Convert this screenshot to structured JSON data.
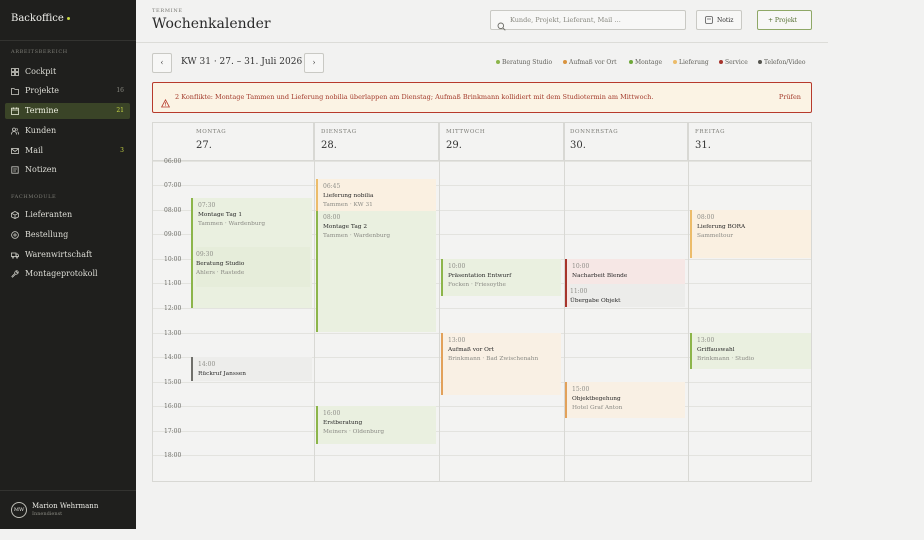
{
  "app": {
    "brand": "Backoffice"
  },
  "sidebar": {
    "section1": "ARBEITSBEREICH",
    "section2": "FACHMODULE",
    "items": [
      {
        "label": "Cockpit",
        "count": "",
        "icon": "grid-icon"
      },
      {
        "label": "Projekte",
        "count": "16",
        "icon": "folder-icon"
      },
      {
        "label": "Termine",
        "count": "21",
        "icon": "calendar-icon"
      },
      {
        "label": "Kunden",
        "count": "",
        "icon": "users-icon"
      },
      {
        "label": "Mail",
        "count": "3",
        "icon": "mail-icon"
      },
      {
        "label": "Notizen",
        "count": "",
        "icon": "note-icon"
      }
    ],
    "modules": [
      {
        "label": "Lieferanten",
        "icon": "box-icon"
      },
      {
        "label": "Bestellung",
        "icon": "package-icon"
      },
      {
        "label": "Warenwirtschaft",
        "icon": "truck-icon"
      },
      {
        "label": "Montageprotokoll",
        "icon": "wrench-icon"
      }
    ],
    "user": {
      "initials": "MW",
      "name": "Marion Wehrmann",
      "role": "Innendienst"
    }
  },
  "header": {
    "kicker": "TERMINE",
    "title": "Wochenkalender",
    "search_placeholder": "Kunde, Projekt, Lieferant, Mail …",
    "notiz_label": "Notiz",
    "projekt_label": "+ Projekt"
  },
  "week": {
    "prev": "‹",
    "next": "›",
    "label": "KW 31 · 27. – 31. Juli 2026"
  },
  "legend": [
    {
      "label": "Beratung Studio",
      "color": "#8cb54a"
    },
    {
      "label": "Aufmaß vor Ort",
      "color": "#d9943f"
    },
    {
      "label": "Montage",
      "color": "#6fa83a"
    },
    {
      "label": "Lieferung",
      "color": "#ecbc6a"
    },
    {
      "label": "Service",
      "color": "#a7342c"
    },
    {
      "label": "Telefon/Video",
      "color": "#55554f"
    }
  ],
  "conflict": {
    "text": "2 Konflikte: Montage Tammen und Lieferung nobilia überlappen am Dienstag; Aufmaß Brinkmann kollidiert mit dem Studiotermin am Mittwoch.",
    "action": "Prüfen"
  },
  "calendar": {
    "days": [
      {
        "name": "MONTAG",
        "date": "27."
      },
      {
        "name": "DIENSTAG",
        "date": "28."
      },
      {
        "name": "MITTWOCH",
        "date": "29."
      },
      {
        "name": "DONNERSTAG",
        "date": "30."
      },
      {
        "name": "FREITAG",
        "date": "31."
      }
    ],
    "hours": [
      "06:00",
      "07:00",
      "08:00",
      "09:00",
      "10:00",
      "11:00",
      "12:00",
      "13:00",
      "14:00",
      "15:00",
      "16:00",
      "17:00",
      "18:00"
    ],
    "events": {
      "mon1": {
        "time": "07:30",
        "title": "Montage Tag 1",
        "sub": "Tammen · Wardenburg"
      },
      "mon2": {
        "time": "09:30",
        "title": "Beratung Studio",
        "sub": "Ahlers · Rastede"
      },
      "mon3": {
        "time": "14:00",
        "title": "Rückruf Janssen",
        "sub": ""
      },
      "tue1": {
        "time": "06:45",
        "title": "Lieferung nobilia",
        "sub": "Tammen · KW 31"
      },
      "tue2": {
        "time": "08:00",
        "title": "Montage Tag 2",
        "sub": "Tammen · Wardenburg"
      },
      "tue3": {
        "time": "16:00",
        "title": "Erstberatung",
        "sub": "Meiners · Oldenburg"
      },
      "wed1": {
        "time": "10:00",
        "title": "Präsentation Entwurf",
        "sub": "Focken · Friesoythe"
      },
      "wed2": {
        "time": "13:00",
        "title": "Aufmaß vor Ort",
        "sub": "Brinkmann · Bad Zwischenahn"
      },
      "thu1": {
        "time": "10:00",
        "title": "Nacharbeit Blende",
        "sub": ""
      },
      "thu2": {
        "time": "11:00",
        "title": "Übergabe Objekt",
        "sub": ""
      },
      "thu3": {
        "time": "15:00",
        "title": "Objektbegehung",
        "sub": "Hotel Graf Anton"
      },
      "fri1": {
        "time": "08:00",
        "title": "Lieferung BORA",
        "sub": "Sammeltour"
      },
      "fri2": {
        "time": "13:00",
        "title": "Griffauswahl",
        "sub": "Brinkmann · Studio"
      }
    }
  }
}
